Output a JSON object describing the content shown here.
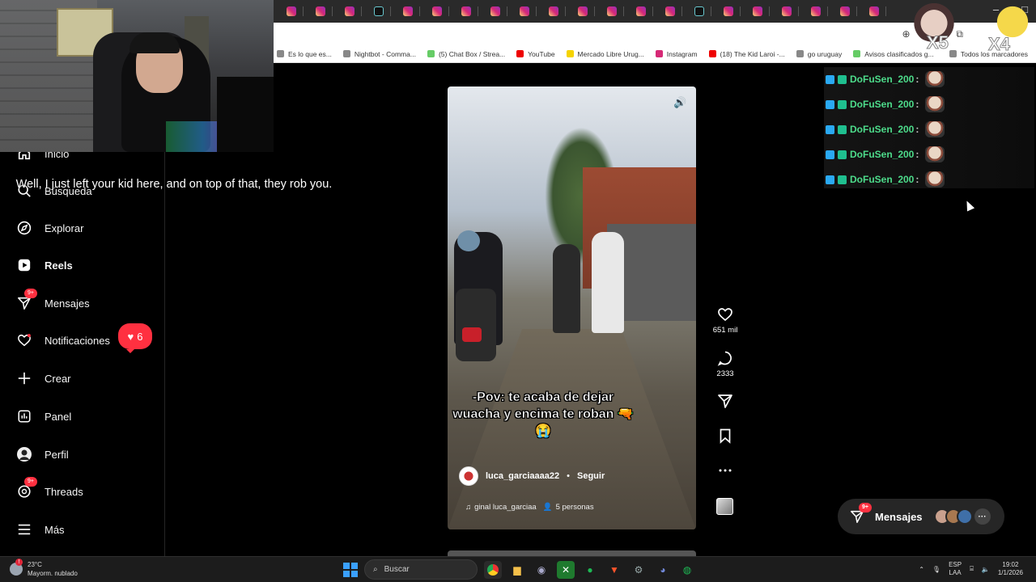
{
  "subtitle": "Well, I just left your kid here, and on top of that, they rob you.",
  "bookmarks": [
    {
      "label": "Es lo que es...",
      "icon": "bookmark-icon"
    },
    {
      "label": "Nightbot - Comma...",
      "icon": "nightbot-icon"
    },
    {
      "label": "(5) Chat Box / Strea...",
      "icon": "chatbox-icon"
    },
    {
      "label": "YouTube",
      "icon": "youtube-icon"
    },
    {
      "label": "Mercado Libre Urug...",
      "icon": "mercadolibre-icon"
    },
    {
      "label": "Instagram",
      "icon": "instagram-icon"
    },
    {
      "label": "(18) The Kid Laroi -...",
      "icon": "youtube-icon"
    },
    {
      "label": "go uruguay",
      "icon": "globe-icon"
    },
    {
      "label": "Avisos clasificados g...",
      "icon": "classifieds-icon"
    }
  ],
  "bookmarks_all": "Todos los marcadores",
  "sidebar": {
    "items": [
      {
        "label": "Inicio"
      },
      {
        "label": "Búsqueda"
      },
      {
        "label": "Explorar"
      },
      {
        "label": "Reels"
      },
      {
        "label": "Mensajes",
        "badge": "9+"
      },
      {
        "label": "Notificaciones"
      },
      {
        "label": "Crear"
      },
      {
        "label": "Panel"
      },
      {
        "label": "Perfil"
      },
      {
        "label": "Threads",
        "badge": "9+"
      },
      {
        "label": "Más"
      }
    ],
    "notif_count": "6"
  },
  "reel": {
    "caption": "-Pov: te acaba de dejar wuacha y encima te roban 🔫😭",
    "username": "luca_garciaaaa22",
    "separator": "•",
    "follow": "Seguir",
    "audio": "ginal  luca_garciaa",
    "people": "5 personas"
  },
  "actions": {
    "likes": "651 mil",
    "comments": "2333"
  },
  "chat": {
    "messages": [
      {
        "user": "DoFuSen_200",
        "colon": ":"
      },
      {
        "user": "DoFuSen_200",
        "colon": ":"
      },
      {
        "user": "DoFuSen_200",
        "colon": ":"
      },
      {
        "user": "DoFuSen_200",
        "colon": ":"
      },
      {
        "user": "DoFuSen_200",
        "colon": ":"
      }
    ]
  },
  "overlay": {
    "x5": "X5",
    "x4": "X4"
  },
  "messages_pill": {
    "label": "Mensajes",
    "badge": "9+",
    "more": "···"
  },
  "taskbar": {
    "temp": "23°C",
    "weather": "Mayorm. nublado",
    "search": "Buscar",
    "lang1": "ESP",
    "lang2": "LAA",
    "time": "19:02",
    "date": "1/1/2026"
  },
  "colors": {
    "accent_red": "#ff3040",
    "chat_name": "#4ddc8b",
    "background": "#000000"
  }
}
